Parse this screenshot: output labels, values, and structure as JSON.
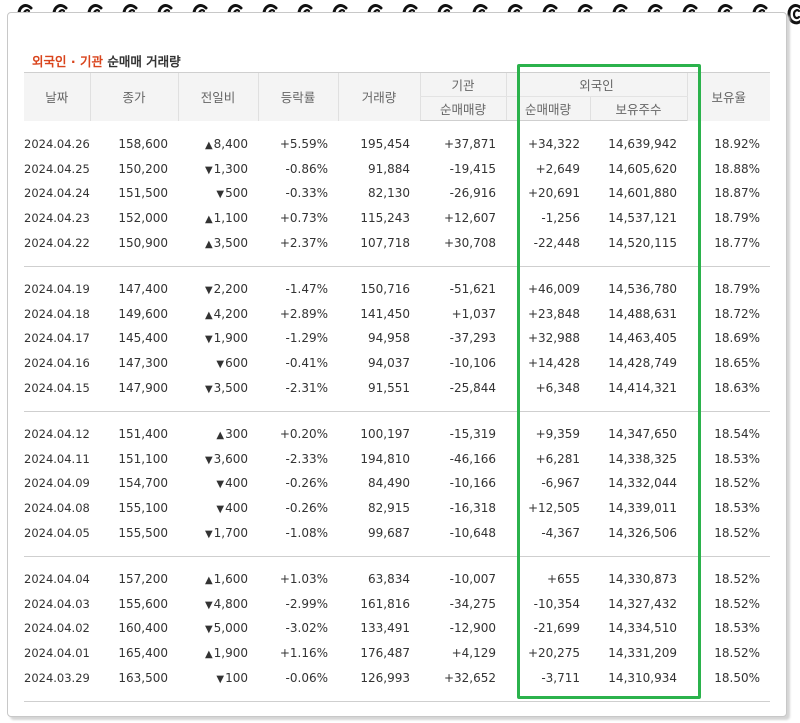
{
  "title": {
    "accent": "외국인 · 기관",
    "rest": "순매매 거래량"
  },
  "headers": {
    "date": "날짜",
    "close": "종가",
    "change": "전일비",
    "rate": "등락률",
    "volume": "거래량",
    "institution": "기관",
    "foreigner": "외국인",
    "inst_net": "순매매량",
    "for_net": "순매매량",
    "for_shares": "보유주수",
    "for_ratio": "보유율"
  },
  "groups": [
    [
      {
        "date": "2024.04.26",
        "close": "158,600",
        "dir": "up",
        "change": "8,400",
        "rate": "+5.59%",
        "volume": "195,454",
        "inst": "+37,871",
        "fnet": "+34,322",
        "shares": "14,639,942",
        "ratio": "18.92%"
      },
      {
        "date": "2024.04.25",
        "close": "150,200",
        "dir": "down",
        "change": "1,300",
        "rate": "-0.86%",
        "volume": "91,884",
        "inst": "-19,415",
        "fnet": "+2,649",
        "shares": "14,605,620",
        "ratio": "18.88%"
      },
      {
        "date": "2024.04.24",
        "close": "151,500",
        "dir": "down",
        "change": "500",
        "rate": "-0.33%",
        "volume": "82,130",
        "inst": "-26,916",
        "fnet": "+20,691",
        "shares": "14,601,880",
        "ratio": "18.87%"
      },
      {
        "date": "2024.04.23",
        "close": "152,000",
        "dir": "up",
        "change": "1,100",
        "rate": "+0.73%",
        "volume": "115,243",
        "inst": "+12,607",
        "fnet": "-1,256",
        "shares": "14,537,121",
        "ratio": "18.79%"
      },
      {
        "date": "2024.04.22",
        "close": "150,900",
        "dir": "up",
        "change": "3,500",
        "rate": "+2.37%",
        "volume": "107,718",
        "inst": "+30,708",
        "fnet": "-22,448",
        "shares": "14,520,115",
        "ratio": "18.77%"
      }
    ],
    [
      {
        "date": "2024.04.19",
        "close": "147,400",
        "dir": "down",
        "change": "2,200",
        "rate": "-1.47%",
        "volume": "150,716",
        "inst": "-51,621",
        "fnet": "+46,009",
        "shares": "14,536,780",
        "ratio": "18.79%"
      },
      {
        "date": "2024.04.18",
        "close": "149,600",
        "dir": "up",
        "change": "4,200",
        "rate": "+2.89%",
        "volume": "141,450",
        "inst": "+1,037",
        "fnet": "+23,848",
        "shares": "14,488,631",
        "ratio": "18.72%"
      },
      {
        "date": "2024.04.17",
        "close": "145,400",
        "dir": "down",
        "change": "1,900",
        "rate": "-1.29%",
        "volume": "94,958",
        "inst": "-37,293",
        "fnet": "+32,988",
        "shares": "14,463,405",
        "ratio": "18.69%"
      },
      {
        "date": "2024.04.16",
        "close": "147,300",
        "dir": "down",
        "change": "600",
        "rate": "-0.41%",
        "volume": "94,037",
        "inst": "-10,106",
        "fnet": "+14,428",
        "shares": "14,428,749",
        "ratio": "18.65%"
      },
      {
        "date": "2024.04.15",
        "close": "147,900",
        "dir": "down",
        "change": "3,500",
        "rate": "-2.31%",
        "volume": "91,551",
        "inst": "-25,844",
        "fnet": "+6,348",
        "shares": "14,414,321",
        "ratio": "18.63%"
      }
    ],
    [
      {
        "date": "2024.04.12",
        "close": "151,400",
        "dir": "up",
        "change": "300",
        "rate": "+0.20%",
        "volume": "100,197",
        "inst": "-15,319",
        "fnet": "+9,359",
        "shares": "14,347,650",
        "ratio": "18.54%"
      },
      {
        "date": "2024.04.11",
        "close": "151,100",
        "dir": "down",
        "change": "3,600",
        "rate": "-2.33%",
        "volume": "194,810",
        "inst": "-46,166",
        "fnet": "+6,281",
        "shares": "14,338,325",
        "ratio": "18.53%"
      },
      {
        "date": "2024.04.09",
        "close": "154,700",
        "dir": "down",
        "change": "400",
        "rate": "-0.26%",
        "volume": "84,490",
        "inst": "-10,166",
        "fnet": "-6,967",
        "shares": "14,332,044",
        "ratio": "18.52%"
      },
      {
        "date": "2024.04.08",
        "close": "155,100",
        "dir": "down",
        "change": "400",
        "rate": "-0.26%",
        "volume": "82,915",
        "inst": "-16,318",
        "fnet": "+12,505",
        "shares": "14,339,011",
        "ratio": "18.53%"
      },
      {
        "date": "2024.04.05",
        "close": "155,500",
        "dir": "down",
        "change": "1,700",
        "rate": "-1.08%",
        "volume": "99,687",
        "inst": "-10,648",
        "fnet": "-4,367",
        "shares": "14,326,506",
        "ratio": "18.52%"
      }
    ],
    [
      {
        "date": "2024.04.04",
        "close": "157,200",
        "dir": "up",
        "change": "1,600",
        "rate": "+1.03%",
        "volume": "63,834",
        "inst": "-10,007",
        "fnet": "+655",
        "shares": "14,330,873",
        "ratio": "18.52%"
      },
      {
        "date": "2024.04.03",
        "close": "155,600",
        "dir": "down",
        "change": "4,800",
        "rate": "-2.99%",
        "volume": "161,816",
        "inst": "-34,275",
        "fnet": "-10,354",
        "shares": "14,327,432",
        "ratio": "18.52%"
      },
      {
        "date": "2024.04.02",
        "close": "160,400",
        "dir": "down",
        "change": "5,000",
        "rate": "-3.02%",
        "volume": "133,491",
        "inst": "-12,900",
        "fnet": "-21,699",
        "shares": "14,334,510",
        "ratio": "18.53%"
      },
      {
        "date": "2024.04.01",
        "close": "165,400",
        "dir": "up",
        "change": "1,900",
        "rate": "+1.16%",
        "volume": "176,487",
        "inst": "+4,129",
        "fnet": "+20,275",
        "shares": "14,331,209",
        "ratio": "18.52%"
      },
      {
        "date": "2024.03.29",
        "close": "163,500",
        "dir": "down",
        "change": "100",
        "rate": "-0.06%",
        "volume": "126,993",
        "inst": "+32,652",
        "fnet": "-3,711",
        "shares": "14,310,934",
        "ratio": "18.50%"
      }
    ]
  ],
  "colors": {
    "up": "#e02020",
    "down": "#1a6fd6",
    "title_accent": "#d9441c",
    "highlight": "#2bb24c"
  },
  "icons": {
    "ring": "spiral-ring-icon",
    "up": "up-triangle-icon",
    "down": "down-triangle-icon"
  }
}
